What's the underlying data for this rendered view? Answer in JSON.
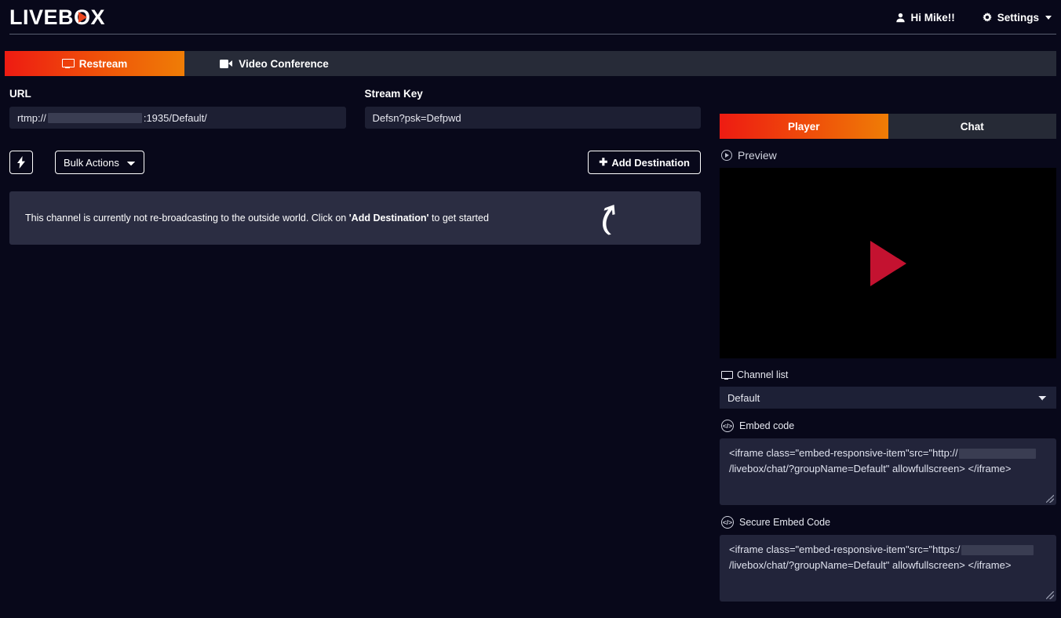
{
  "brand": {
    "name_part1": "LIVEB",
    "name_o": "O",
    "name_part2": "X",
    "accent_start": "#ee1b12",
    "accent_end": "#ef7d06"
  },
  "header": {
    "user_greeting": "Hi Mike!!",
    "user_icon": "user-icon",
    "settings_label": "Settings",
    "settings_icon": "gear-icon",
    "caret_icon": "caret-down-icon"
  },
  "main_tabs": [
    {
      "label": "Restream",
      "icon": "monitor-icon",
      "active": true
    },
    {
      "label": "Video Conference",
      "icon": "videocam-icon",
      "active": false
    }
  ],
  "form": {
    "url": {
      "label": "URL",
      "prefix": "rtmp://",
      "redacted": "",
      "suffix": ":1935/Default/"
    },
    "stream_key": {
      "label": "Stream Key",
      "value": "Defsn?psk=Defpwd"
    }
  },
  "toolbar": {
    "bolt_icon": "lightning-bolt-icon",
    "bulk_actions_label": "Bulk Actions",
    "bulk_actions_options": [
      "Bulk Actions"
    ],
    "add_destination_label": "Add Destination",
    "add_destination_icon": "plus-icon"
  },
  "alert": {
    "text_before": "This channel is currently not re-broadcasting to the outside world. Click on ",
    "text_bold": "'Add Destination'",
    "text_after": " to get started",
    "arrow_icon": "curved-arrow-up-icon"
  },
  "preview_panel": {
    "tabs": [
      {
        "label": "Player",
        "active": true
      },
      {
        "label": "Chat",
        "active": false
      }
    ],
    "preview_label": "Preview",
    "preview_icon": "play-circle-icon",
    "play_button_icon": "play-triangle-icon",
    "play_button_color": "#c41230",
    "channel_list": {
      "label": "Channel list",
      "icon": "monitor-icon",
      "selected": "Default",
      "options": [
        "Default"
      ]
    },
    "embed_code": {
      "label": "Embed code",
      "icon": "code-icon",
      "part1": "<iframe class=\"embed-responsive-item\"src=\"http://",
      "redacted": "",
      "part2": "/livebox/chat/?groupName=Default\" allowfullscreen> </iframe>"
    },
    "secure_embed_code": {
      "label": "Secure Embed Code",
      "icon": "code-icon",
      "part1": "<iframe class=\"embed-responsive-item\"src=\"https:/",
      "redacted": "",
      "part2": "/livebox/chat/?groupName=Default\" allowfullscreen> </iframe>"
    }
  }
}
